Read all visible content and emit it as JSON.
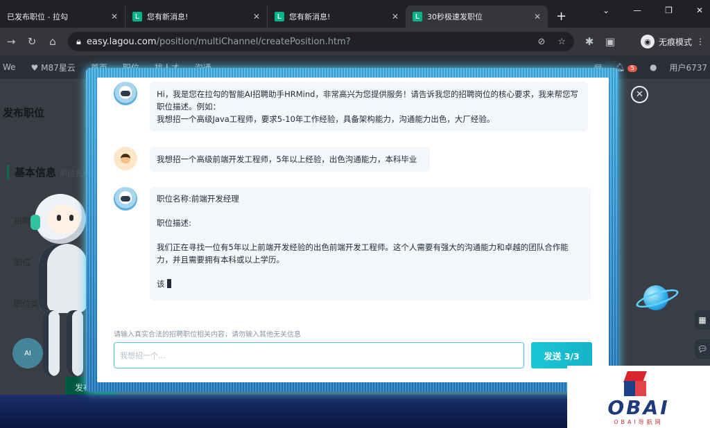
{
  "browser": {
    "tabs": [
      {
        "title": "已发布职位 - 拉勾",
        "favicon": ""
      },
      {
        "title": "您有新消息!",
        "favicon": "L"
      },
      {
        "title": "您有新消息!",
        "favicon": "L"
      },
      {
        "title": "30秒极速发职位",
        "favicon": "L"
      }
    ],
    "url_host": "easy.lagou.com",
    "url_path": "/position/multiChannel/createPosition.htm?",
    "profile_label": "无痕模式"
  },
  "site_header": {
    "left_text": "We",
    "company": "M87星云",
    "nav": [
      "首页",
      "职位",
      "找人才",
      "沟通"
    ],
    "notifications_count": "5",
    "user": "用户6737"
  },
  "background_page": {
    "title": "发布职位",
    "section": "基本信息",
    "section_hint": "职位名称",
    "fields": [
      "招聘",
      "职位",
      "职位类别"
    ],
    "publish_button": "发布"
  },
  "chat": {
    "messages": [
      {
        "role": "bot",
        "lines": [
          "Hi，我是您在拉勾的智能AI招聘助手HRMind，非常高兴为您提供服务！请告诉我您的招聘岗位的核心要求，我来帮您写职位描述。例如：",
          "我想招一个高级Java工程师，要求5-10年工作经验，具备架构能力，沟通能力出色，大厂经验。"
        ]
      },
      {
        "role": "user",
        "lines": [
          "我想招一个高级前端开发工程师，5年以上经验，出色沟通能力，本科毕业"
        ]
      },
      {
        "role": "bot",
        "lines": [
          "职位名称:前端开发经理",
          "职位描述:",
          "我们正在寻找一位有5年以上前端开发经验的出色前端开发工程师。这个人需要有强大的沟通能力和卓越的团队合作能力，并且需要拥有本科或以上学历。",
          "该"
        ]
      }
    ],
    "input_hint": "请输入真实合法的招聘职位相关内容，请勿输入其他无关信息",
    "input_placeholder": "我想招一个...",
    "send_label": "发送 3/3"
  },
  "watermark": {
    "name": "OBAI",
    "subtitle": "OBAI导航网"
  },
  "colors": {
    "accent": "#1cc6d4",
    "brand_green": "#00b38a",
    "frame_glow": "#58d2ff"
  }
}
